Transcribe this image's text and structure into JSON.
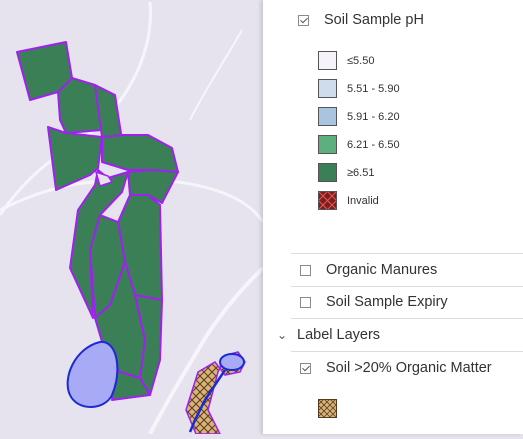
{
  "map": {
    "colors": {
      "background": "#e6e3ee",
      "field_fill": "#3a7f55",
      "field_border": "#a020f0",
      "pond_fill": "#a9aaf5",
      "pond_border": "#1a2bd6",
      "hatch_fill": "#d8b47a"
    }
  },
  "panel": {
    "soil_ph_layer": {
      "label": "Soil Sample pH",
      "checked": true,
      "legend": [
        {
          "label": "≤5.50",
          "color": "#f5f2fa"
        },
        {
          "label": "5.51 - 5.90",
          "color": "#cfdcec"
        },
        {
          "label": "5.91 - 6.20",
          "color": "#a9c4e1"
        },
        {
          "label": "6.21 - 6.50",
          "color": "#5bb07d"
        },
        {
          "label": "≥6.51",
          "color": "#3a7f55"
        },
        {
          "label": "Invalid",
          "color": "#7a1e1e"
        }
      ]
    },
    "organic_manures": {
      "label": "Organic Manures",
      "checked": false
    },
    "soil_sample_expiry": {
      "label": "Soil Sample Expiry",
      "checked": false
    },
    "label_layers_group": {
      "label": "Label Layers",
      "icon": "chevron-down-icon"
    },
    "soil_organic_matter": {
      "label": "Soil >20% Organic Matter",
      "checked": true
    }
  }
}
